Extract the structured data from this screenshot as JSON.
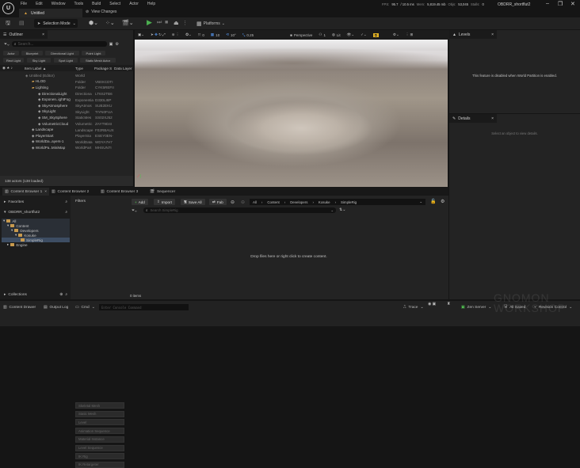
{
  "app": {
    "logo": "U",
    "menu": [
      "File",
      "Edit",
      "Window",
      "Tools",
      "Build",
      "Select",
      "Actor",
      "Help"
    ],
    "doc_tab": "Untitled",
    "view_changes": "View Changes",
    "project": "OBDRR_shortflut2"
  },
  "stats": {
    "fps_label": "FPS:",
    "fps": "95.7",
    "ms": "/ 10.5 ms",
    "mem_label": "Mem:",
    "mem": "5,819.45 mb",
    "objs_label": "Objs:",
    "objs": "53,045",
    "stalls_label": "Stalls:",
    "stalls": "0"
  },
  "window_buttons": {
    "min": "–",
    "max": "❐",
    "close": "✕"
  },
  "toolbar": {
    "selection_mode": "Selection Mode",
    "platforms": "Platforms"
  },
  "outliner": {
    "title": "Outliner",
    "search_placeholder": "Search...",
    "filters": [
      "Actor",
      "Blueprint",
      "Directional Light",
      "Point Light",
      "Rect Light",
      "Sky Light",
      "Spot Light",
      "Static Mesh Actor"
    ],
    "columns": [
      "Item Label ▲",
      "Type",
      "Package S",
      "Data Layer"
    ],
    "rows": [
      {
        "label": "Untitled (Editor)",
        "type": "World",
        "pkg": "",
        "indent": 0,
        "dim": true
      },
      {
        "label": "HLOD",
        "type": "Folder",
        "pkg": "VB0XCDTI",
        "indent": 1
      },
      {
        "label": "Lighting",
        "type": "Folder",
        "pkg": "CYK5REFII",
        "indent": 1
      },
      {
        "label": "DirectionalLight",
        "type": "Directiona",
        "pkg": "LT6S2TB6",
        "indent": 2
      },
      {
        "label": "Exponen..ightFog",
        "type": "Exponentia",
        "pkg": "D330LI8P",
        "indent": 2
      },
      {
        "label": "SkyAtmosphere",
        "type": "SkyAtmos",
        "pkg": "SUB2EKU",
        "indent": 2
      },
      {
        "label": "SkyLight",
        "type": "SkyLight",
        "pkg": "TIYN0FUA",
        "indent": 2
      },
      {
        "label": "SM_SkySphere",
        "type": "StaticMes",
        "pkg": "SS02XJ52",
        "indent": 2
      },
      {
        "label": "VolumetricCloud",
        "type": "Volumetric",
        "pkg": "ZAYT9D4I",
        "indent": 2
      },
      {
        "label": "Landscape",
        "type": "Landscape",
        "pkg": "F02RBAUX",
        "indent": 1
      },
      {
        "label": "PlayerStart",
        "type": "PlayerSta",
        "pkg": "ESEY0EN-",
        "indent": 1
      },
      {
        "label": "WorldDa..ayers-1",
        "type": "WorldDatа",
        "pkg": "WDYA7H7",
        "indent": 1
      },
      {
        "label": "WorldPa..MiniMap",
        "type": "WorldPart",
        "pkg": "MHSUN7I",
        "indent": 1
      }
    ],
    "footer": "138 actors (138 loaded)"
  },
  "viewport": {
    "perspective": "Perspective",
    "lit": "Lit",
    "snap_translate": "10",
    "snap_rotate": "10°",
    "snap_scale": "0.25",
    "grid": "0",
    "cam": "1"
  },
  "levels": {
    "title": "Levels",
    "message": "This feature is disabled when World Partition is enabled."
  },
  "details": {
    "title": "Details",
    "message": "Select an object to view details."
  },
  "content": {
    "tabs": [
      "Content Browser 1",
      "Content Browser 2",
      "Content Browser 3",
      "Sequencer"
    ],
    "favorites": "Favorites",
    "project_root": "OBDRR_shortflut2",
    "tree": [
      {
        "label": "All",
        "indent": 0
      },
      {
        "label": "Content",
        "indent": 1
      },
      {
        "label": "Developers",
        "indent": 2
      },
      {
        "label": "Kosuke",
        "indent": 3
      },
      {
        "label": "SimpleRig",
        "indent": 4,
        "selected": true
      },
      {
        "label": "Engine",
        "indent": 1
      }
    ],
    "collections": "Collections",
    "filters_title": "Filters",
    "filters": [
      "Skeletal Mesh",
      "Static Mesh",
      "Level",
      "Animation Sequence",
      "Material Instance",
      "Level Sequence",
      "IK Rig",
      "IK Retargeter"
    ],
    "add": "Add",
    "import": "Import",
    "save_all": "Save All",
    "fab": "Fab",
    "breadcrumb": [
      "All",
      "Content",
      "Developers",
      "Kosuke",
      "SimpleRig"
    ],
    "search_placeholder": "Search SimpleRig",
    "empty": "Drop files here or right click to create content.",
    "count": "0 items"
  },
  "statusbar": {
    "content_drawer": "Content Drawer",
    "output_log": "Output Log",
    "cmd": "Cmd",
    "console_placeholder": "Enter Console Command",
    "trace": "Trace",
    "zen": "Zen Server",
    "saved": "All Saved",
    "revision": "Revision Control"
  },
  "watermark": {
    "line1": "GNOMON",
    "line2": "WORKSHOP",
    "the": "the"
  }
}
